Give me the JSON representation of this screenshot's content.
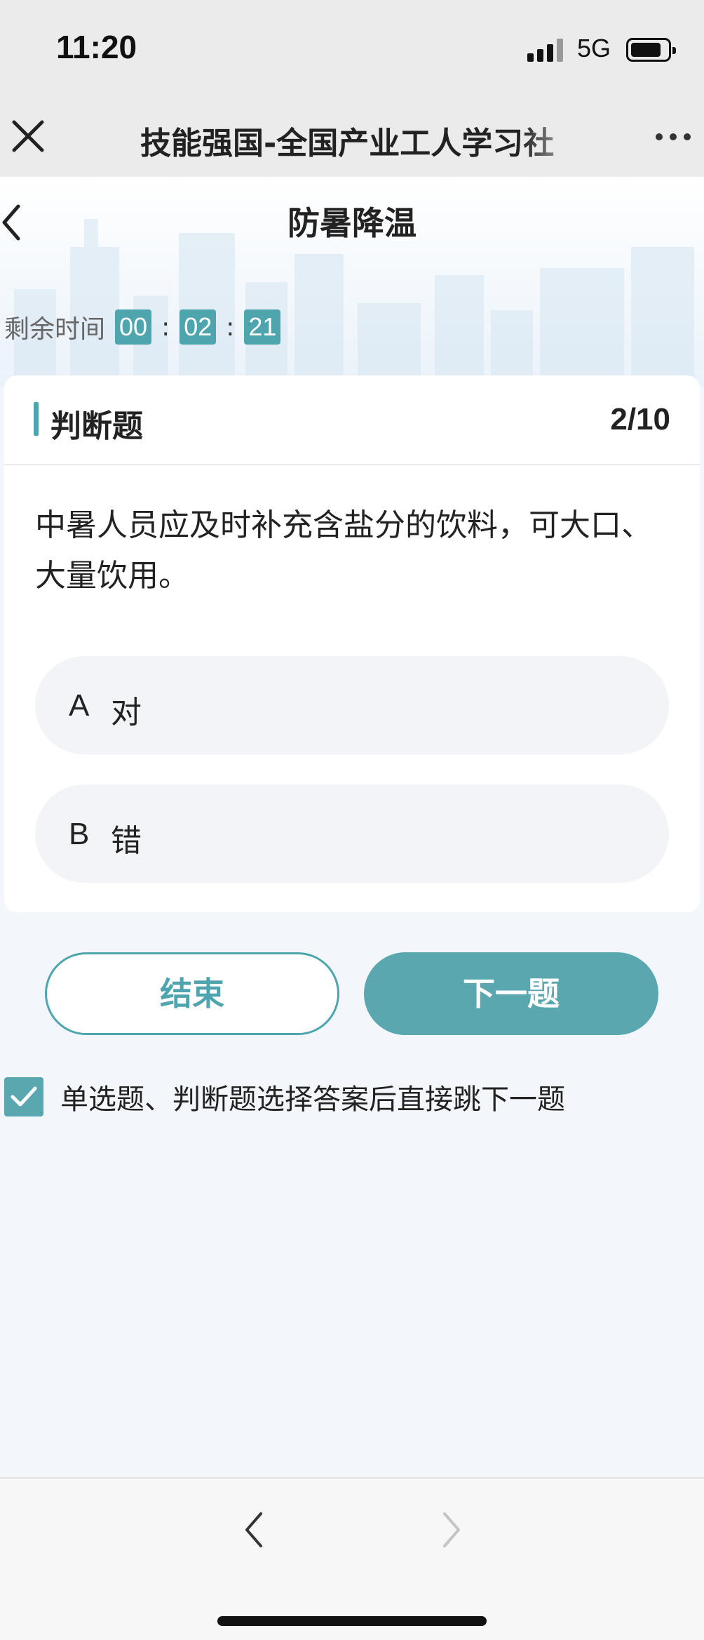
{
  "status_bar": {
    "time": "11:20",
    "network": "5G",
    "icons": [
      "signal-icon",
      "battery-icon"
    ]
  },
  "title_bar": {
    "title": "技能强国-全国产业工人学习社",
    "close_icon": "close-icon",
    "more_icon": "more-icon"
  },
  "page": {
    "title": "防暑降温",
    "back_icon": "chevron-left-icon",
    "timer": {
      "label": "剩余时间",
      "hours": "00",
      "minutes": "02",
      "seconds": "21",
      "separator": ":"
    }
  },
  "question_card": {
    "type": "判断题",
    "progress": "2/10",
    "question": "中暑人员应及时补充含盐分的饮料，可大口、大量饮用。",
    "options": [
      {
        "key": "A",
        "text": "对"
      },
      {
        "key": "B",
        "text": "错"
      }
    ]
  },
  "actions": {
    "end_label": "结束",
    "next_label": "下一题"
  },
  "auto_next": {
    "checked": true,
    "label": "单选题、判断题选择答案后直接跳下一题"
  },
  "bottom_nav": {
    "back_icon": "chevron-left-icon",
    "forward_icon": "chevron-right-icon"
  },
  "colors": {
    "accent": "#4ea5ad",
    "button_fill": "#5aa7b0",
    "background": "#f3f7fb"
  }
}
